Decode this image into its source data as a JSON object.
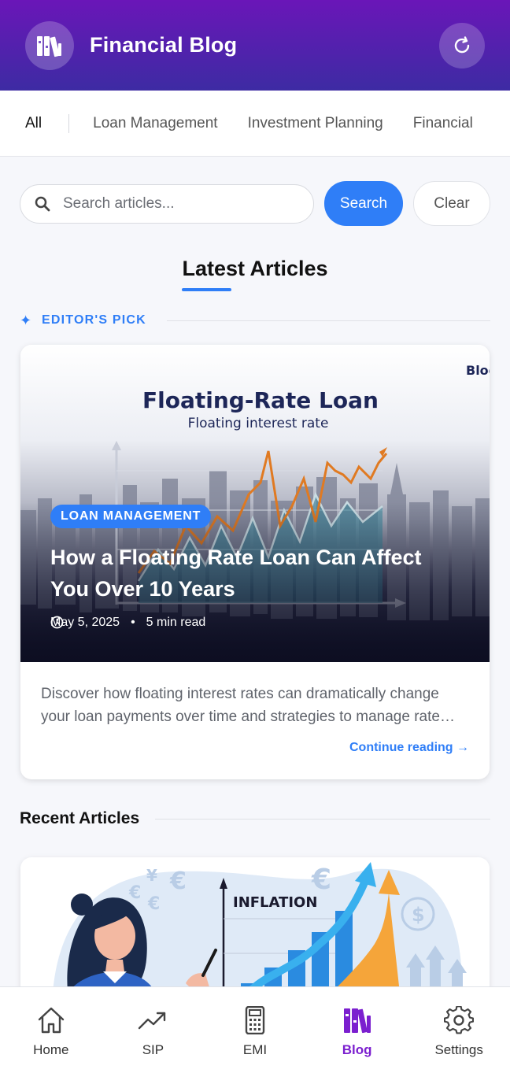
{
  "header": {
    "title": "Financial Blog",
    "logo_icon": "books-icon",
    "refresh_icon": "refresh-icon"
  },
  "tabs": [
    {
      "label": "All",
      "active": true
    },
    {
      "label": "Loan Management",
      "active": false
    },
    {
      "label": "Investment Planning",
      "active": false
    },
    {
      "label": "Financial",
      "active": false
    }
  ],
  "search": {
    "placeholder": "Search articles...",
    "value": "",
    "search_label": "Search",
    "clear_label": "Clear"
  },
  "main": {
    "section_title": "Latest Articles",
    "editor_pick_label": "EDITOR'S PICK",
    "featured": {
      "image_heading": "Floating-Rate Loan",
      "image_subheading": "Floating interest rate",
      "image_corner_text": "Blog",
      "category": "LOAN MANAGEMENT",
      "title": "How a Floating Rate Loan Can Affect You Over 10 Years",
      "date": "May 5, 2025",
      "read_time": "5 min read",
      "excerpt": "Discover how floating interest rates can dramatically change your loan payments over time and strategies to manage rate fluctuations.",
      "continue_label": "Continue reading →"
    },
    "recent_label": "Recent Articles",
    "recent_card": {
      "image_text": "INFLATION"
    }
  },
  "bottom_nav": [
    {
      "label": "Home",
      "icon": "home-icon",
      "active": false
    },
    {
      "label": "SIP",
      "icon": "trend-up-icon",
      "active": false
    },
    {
      "label": "EMI",
      "icon": "calculator-icon",
      "active": false
    },
    {
      "label": "Blog",
      "icon": "books-icon",
      "active": true
    },
    {
      "label": "Settings",
      "icon": "gear-icon",
      "active": false
    }
  ],
  "colors": {
    "primary": "#2f7ef7",
    "header_start": "#6a16b8",
    "header_end": "#3d2ba3",
    "nav_active": "#7b1fcf"
  }
}
